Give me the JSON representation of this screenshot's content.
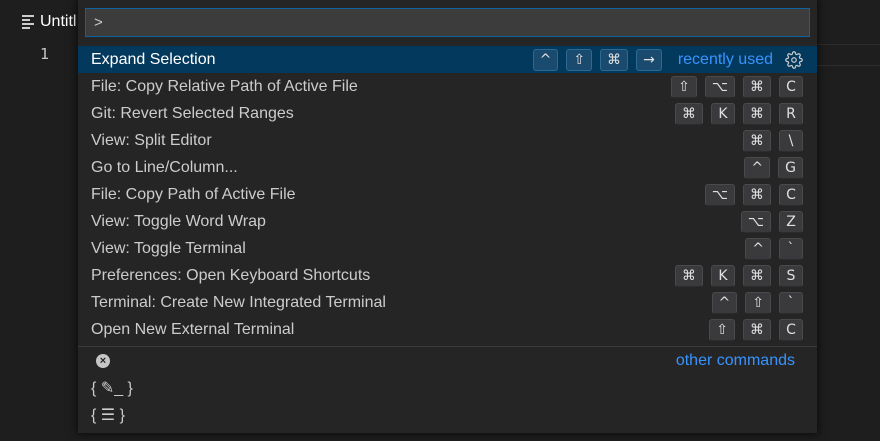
{
  "editor": {
    "tab_title": "Untitl",
    "line_number": "1"
  },
  "quick_pick": {
    "input_value": ">",
    "items": [
      {
        "label": "Expand Selection",
        "keys": [
          "^",
          "⇧",
          "⌘",
          "→"
        ],
        "badge": "recently used",
        "selected": true
      },
      {
        "label": "File: Copy Relative Path of Active File",
        "keys": [
          "⇧",
          "⌥",
          "⌘",
          "C"
        ]
      },
      {
        "label": "Git: Revert Selected Ranges",
        "keys": [
          "⌘",
          "K",
          "⌘",
          "R"
        ]
      },
      {
        "label": "View: Split Editor",
        "keys": [
          "⌘",
          "\\"
        ]
      },
      {
        "label": "Go to Line/Column...",
        "keys": [
          "^",
          "G"
        ]
      },
      {
        "label": "File: Copy Path of Active File",
        "keys": [
          "⌥",
          "⌘",
          "C"
        ]
      },
      {
        "label": "View: Toggle Word Wrap",
        "keys": [
          "⌥",
          "Z"
        ]
      },
      {
        "label": "View: Toggle Terminal",
        "keys": [
          "^",
          "`"
        ]
      },
      {
        "label": "Preferences: Open Keyboard Shortcuts",
        "keys": [
          "⌘",
          "K",
          "⌘",
          "S"
        ]
      },
      {
        "label": "Terminal: Create New Integrated Terminal",
        "keys": [
          "^",
          "⇧",
          "`"
        ]
      },
      {
        "label": "Open New External Terminal",
        "keys": [
          "⇧",
          "⌘",
          "C"
        ]
      }
    ],
    "other_commands": "other commands",
    "snippet_rows": [
      "{ ✎_ }",
      "{ ☰ }"
    ]
  },
  "colors": {
    "accent": "#3794ff",
    "selection": "#04395e",
    "focus_border": "#0e639c"
  }
}
